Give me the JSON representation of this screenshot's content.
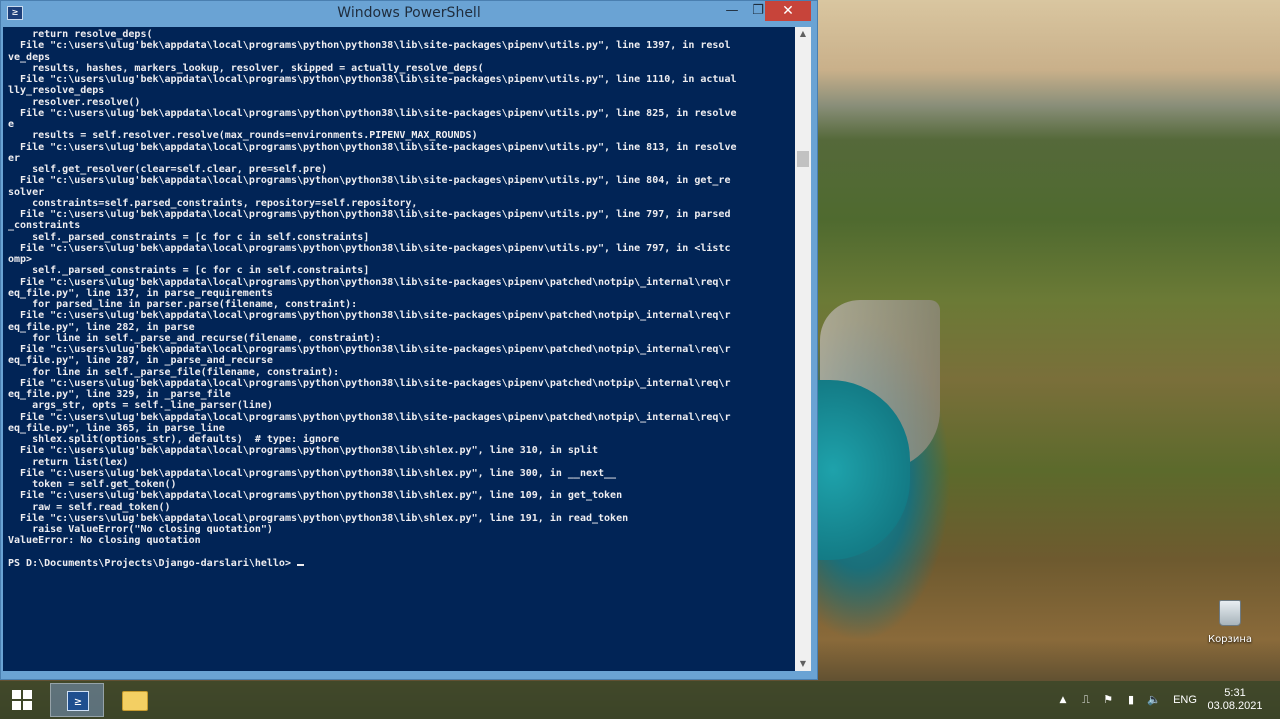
{
  "window": {
    "title": "Windows PowerShell",
    "controls": {
      "minimize": "—",
      "maximize": "❐",
      "close": "✕"
    }
  },
  "console_lines": [
    "    return resolve_deps(",
    "  File \"c:\\users\\ulug'bek\\appdata\\local\\programs\\python\\python38\\lib\\site-packages\\pipenv\\utils.py\", line 1397, in resol",
    "ve_deps",
    "    results, hashes, markers_lookup, resolver, skipped = actually_resolve_deps(",
    "  File \"c:\\users\\ulug'bek\\appdata\\local\\programs\\python\\python38\\lib\\site-packages\\pipenv\\utils.py\", line 1110, in actual",
    "lly_resolve_deps",
    "    resolver.resolve()",
    "  File \"c:\\users\\ulug'bek\\appdata\\local\\programs\\python\\python38\\lib\\site-packages\\pipenv\\utils.py\", line 825, in resolve",
    "e",
    "    results = self.resolver.resolve(max_rounds=environments.PIPENV_MAX_ROUNDS)",
    "  File \"c:\\users\\ulug'bek\\appdata\\local\\programs\\python\\python38\\lib\\site-packages\\pipenv\\utils.py\", line 813, in resolve",
    "er",
    "    self.get_resolver(clear=self.clear, pre=self.pre)",
    "  File \"c:\\users\\ulug'bek\\appdata\\local\\programs\\python\\python38\\lib\\site-packages\\pipenv\\utils.py\", line 804, in get_re",
    "solver",
    "    constraints=self.parsed_constraints, repository=self.repository,",
    "  File \"c:\\users\\ulug'bek\\appdata\\local\\programs\\python\\python38\\lib\\site-packages\\pipenv\\utils.py\", line 797, in parsed",
    "_constraints",
    "    self._parsed_constraints = [c for c in self.constraints]",
    "  File \"c:\\users\\ulug'bek\\appdata\\local\\programs\\python\\python38\\lib\\site-packages\\pipenv\\utils.py\", line 797, in <listc",
    "omp>",
    "    self._parsed_constraints = [c for c in self.constraints]",
    "  File \"c:\\users\\ulug'bek\\appdata\\local\\programs\\python\\python38\\lib\\site-packages\\pipenv\\patched\\notpip\\_internal\\req\\r",
    "eq_file.py\", line 137, in parse_requirements",
    "    for parsed_line in parser.parse(filename, constraint):",
    "  File \"c:\\users\\ulug'bek\\appdata\\local\\programs\\python\\python38\\lib\\site-packages\\pipenv\\patched\\notpip\\_internal\\req\\r",
    "eq_file.py\", line 282, in parse",
    "    for line in self._parse_and_recurse(filename, constraint):",
    "  File \"c:\\users\\ulug'bek\\appdata\\local\\programs\\python\\python38\\lib\\site-packages\\pipenv\\patched\\notpip\\_internal\\req\\r",
    "eq_file.py\", line 287, in _parse_and_recurse",
    "    for line in self._parse_file(filename, constraint):",
    "  File \"c:\\users\\ulug'bek\\appdata\\local\\programs\\python\\python38\\lib\\site-packages\\pipenv\\patched\\notpip\\_internal\\req\\r",
    "eq_file.py\", line 329, in _parse_file",
    "    args_str, opts = self._line_parser(line)",
    "  File \"c:\\users\\ulug'bek\\appdata\\local\\programs\\python\\python38\\lib\\site-packages\\pipenv\\patched\\notpip\\_internal\\req\\r",
    "eq_file.py\", line 365, in parse_line",
    "    shlex.split(options_str), defaults)  # type: ignore",
    "  File \"c:\\users\\ulug'bek\\appdata\\local\\programs\\python\\python38\\lib\\shlex.py\", line 310, in split",
    "    return list(lex)",
    "  File \"c:\\users\\ulug'bek\\appdata\\local\\programs\\python\\python38\\lib\\shlex.py\", line 300, in __next__",
    "    token = self.get_token()",
    "  File \"c:\\users\\ulug'bek\\appdata\\local\\programs\\python\\python38\\lib\\shlex.py\", line 109, in get_token",
    "    raw = self.read_token()",
    "  File \"c:\\users\\ulug'bek\\appdata\\local\\programs\\python\\python38\\lib\\shlex.py\", line 191, in read_token",
    "    raise ValueError(\"No closing quotation\")",
    "ValueError: No closing quotation",
    "",
    "PS D:\\Documents\\Projects\\Django-darslari\\hello> "
  ],
  "desktop": {
    "recycle_bin_label": "Корзина"
  },
  "taskbar": {
    "language": "ENG",
    "time": "5:31",
    "date": "03.08.2021",
    "tray_up_arrow": "▲"
  },
  "icons": {
    "start": "windows-logo-icon",
    "powershell": "powershell-icon",
    "explorer": "file-explorer-icon",
    "network": "network-icon",
    "flag": "action-center-flag-icon",
    "battery": "battery-icon",
    "volume": "volume-icon",
    "recycle": "recycle-bin-icon"
  }
}
